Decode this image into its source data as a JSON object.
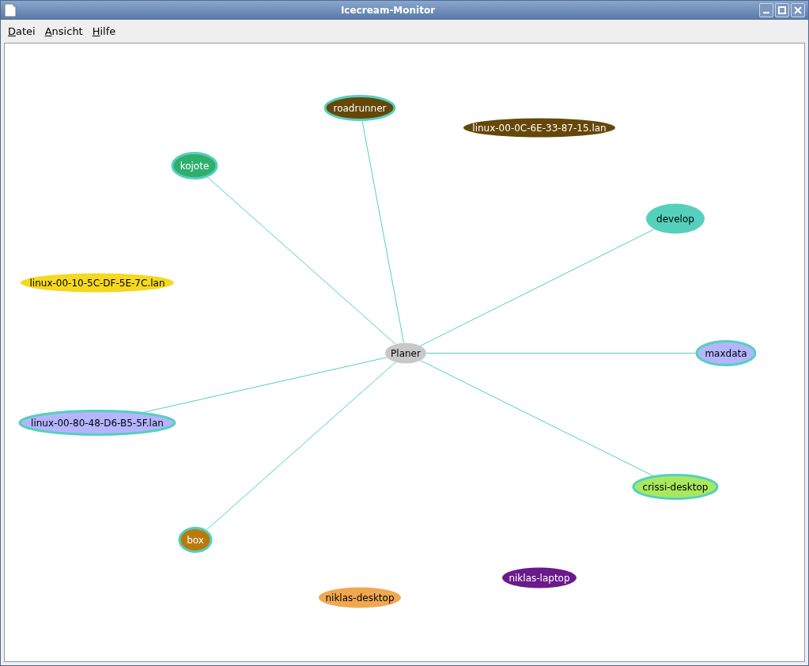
{
  "window": {
    "title": "Icecream-Monitor"
  },
  "menu": [
    "Datei",
    "Ansicht",
    "Hilfe"
  ],
  "scheduler": {
    "label": "Planer",
    "color": "#c8c8c8"
  },
  "hosts": [
    {
      "label": "roadrunner",
      "color": "#654709",
      "busy": true,
      "connected": true
    },
    {
      "label": "linux-00-0C-6E-33-87-15.lan",
      "color": "#654709",
      "busy": false,
      "connected": false
    },
    {
      "label": "kojote",
      "color": "#2fae6e",
      "busy": true,
      "connected": true
    },
    {
      "label": "develop",
      "color": "#55d0bd",
      "busy": false,
      "connected": true
    },
    {
      "label": "linux-00-10-5C-DF-5E-7C.lan",
      "color": "#f5d820",
      "busy": false,
      "connected": false
    },
    {
      "label": "maxdata",
      "color": "#b4b4ff",
      "busy": true,
      "connected": true
    },
    {
      "label": "linux-00-80-48-D6-B5-5F.lan",
      "color": "#b4b4ff",
      "busy": true,
      "connected": true
    },
    {
      "label": "crissi-desktop",
      "color": "#a8e860",
      "busy": true,
      "connected": true
    },
    {
      "label": "box",
      "color": "#b87a10",
      "busy": true,
      "connected": true
    },
    {
      "label": "niklas-laptop",
      "color": "#6a1a8a",
      "busy": false,
      "connected": false
    },
    {
      "label": "niklas-desktop",
      "color": "#f0a850",
      "busy": false,
      "connected": false
    }
  ]
}
